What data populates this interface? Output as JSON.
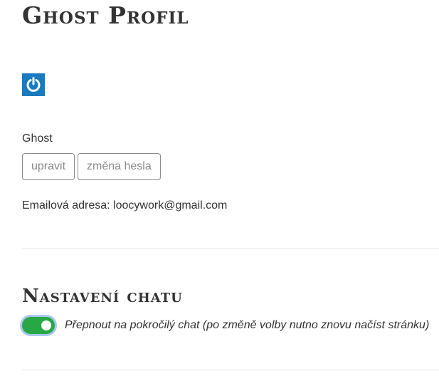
{
  "profile": {
    "title": "Ghost Profil",
    "avatar_icon": "power-icon",
    "avatar_color": "#1a7abf",
    "username": "Ghost",
    "edit_label": "upravit",
    "change_password_label": "změna hesla",
    "email_label": "Emailová adresa:",
    "email_value": "loocywork@gmail.com"
  },
  "chat_settings": {
    "title": "Nastavení chatu",
    "advanced_chat_toggle": {
      "on": true,
      "label": "Přepnout na pokročilý chat (po změně volby nutno znovu načíst stránku)",
      "color": "#28a745"
    }
  }
}
